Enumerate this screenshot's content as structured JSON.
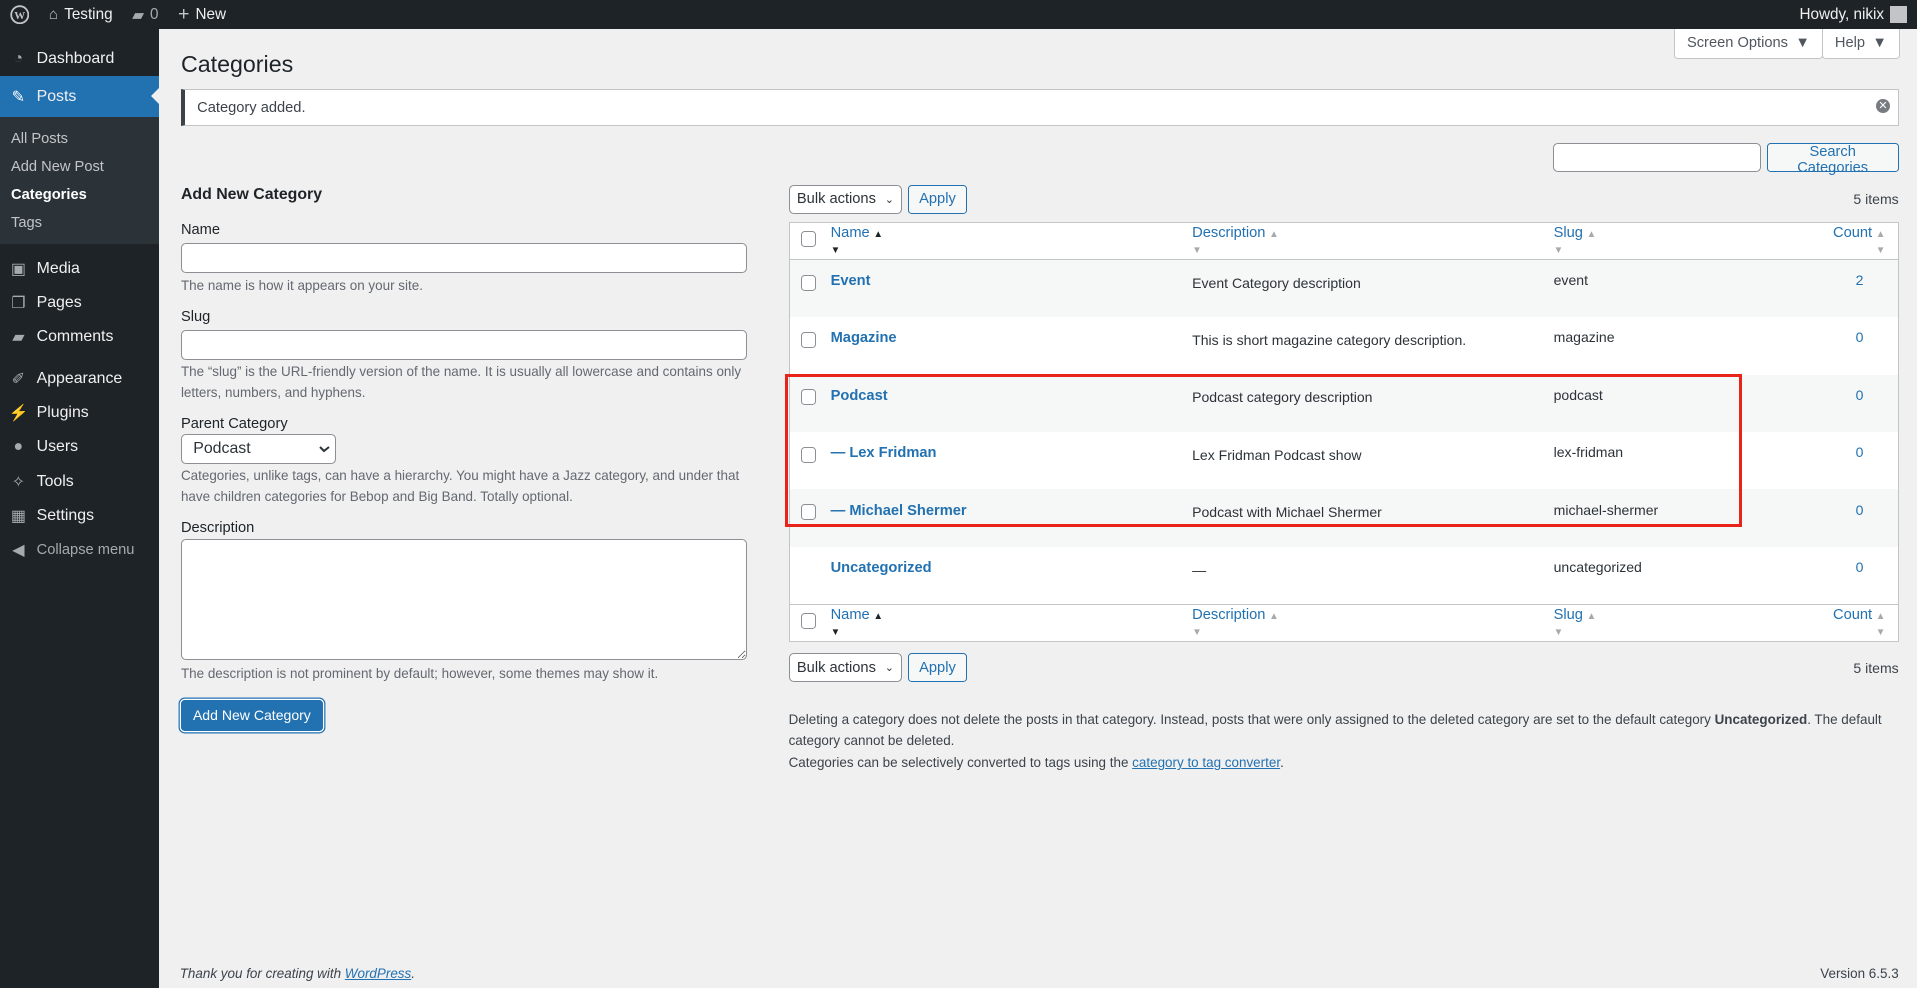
{
  "admin_bar": {
    "site": "Testing",
    "comments": "0",
    "new": "New",
    "howdy": "Howdy, nikix"
  },
  "sidebar": {
    "items": [
      {
        "label": "Dashboard",
        "icon": "dashboard-icon"
      },
      {
        "label": "Posts",
        "icon": "pin-icon",
        "current": true
      },
      {
        "label": "Media",
        "icon": "media-icon"
      },
      {
        "label": "Pages",
        "icon": "pages-icon"
      },
      {
        "label": "Comments",
        "icon": "comment-icon"
      },
      {
        "label": "Appearance",
        "icon": "brush-icon"
      },
      {
        "label": "Plugins",
        "icon": "plugin-icon"
      },
      {
        "label": "Users",
        "icon": "user-icon"
      },
      {
        "label": "Tools",
        "icon": "wrench-icon"
      },
      {
        "label": "Settings",
        "icon": "settings-icon"
      },
      {
        "label": "Collapse menu",
        "icon": "collapse-icon"
      }
    ],
    "submenu": [
      "All Posts",
      "Add New Post",
      "Categories",
      "Tags"
    ]
  },
  "page": {
    "title": "Categories",
    "screen_options": "Screen Options",
    "help": "Help",
    "notice": "Category added.",
    "search_button": "Search Categories",
    "search_value": ""
  },
  "form": {
    "heading": "Add New Category",
    "name_label": "Name",
    "name_help": "The name is how it appears on your site.",
    "slug_label": "Slug",
    "slug_help": "The “slug” is the URL-friendly version of the name. It is usually all lowercase and contains only letters, numbers, and hyphens.",
    "parent_label": "Parent Category",
    "parent_value": "Podcast",
    "parent_help": "Categories, unlike tags, can have a hierarchy. You might have a Jazz category, and under that have children categories for Bebop and Big Band. Totally optional.",
    "desc_label": "Description",
    "desc_help": "The description is not prominent by default; however, some themes may show it.",
    "submit": "Add New Category"
  },
  "table": {
    "bulk": "Bulk actions",
    "apply": "Apply",
    "items": "5 items",
    "columns": [
      "Name",
      "Description",
      "Slug",
      "Count"
    ],
    "rows": [
      {
        "name": "Event",
        "desc": "Event Category description",
        "slug": "event",
        "count": "2",
        "checkbox": true
      },
      {
        "name": "Magazine",
        "desc": "This is short magazine category description.",
        "slug": "magazine",
        "count": "0",
        "checkbox": true
      },
      {
        "name": "Podcast",
        "desc": "Podcast category description",
        "slug": "podcast",
        "count": "0",
        "checkbox": true
      },
      {
        "name": "— Lex Fridman",
        "desc": "Lex Fridman Podcast show",
        "slug": "lex-fridman",
        "count": "0",
        "checkbox": true
      },
      {
        "name": "— Michael Shermer",
        "desc": "Podcast with Michael Shermer",
        "slug": "michael-shermer",
        "count": "0",
        "checkbox": true
      },
      {
        "name": "Uncategorized",
        "desc": "—",
        "slug": "uncategorized",
        "count": "0",
        "checkbox": false
      }
    ]
  },
  "notes": {
    "p1a": "Deleting a category does not delete the posts in that category. Instead, posts that were only assigned to the deleted category are set to the default category ",
    "p1b": "Uncategorized",
    "p1c": ". The default category cannot be deleted.",
    "p2a": "Categories can be selectively converted to tags using the ",
    "p2link": "category to tag converter",
    "p2b": "."
  },
  "footer": {
    "thanks": "Thank you for creating with ",
    "wp": "WordPress",
    "dot": ".",
    "version": "Version 6.5.3"
  },
  "highlight_color": "#e8231a"
}
